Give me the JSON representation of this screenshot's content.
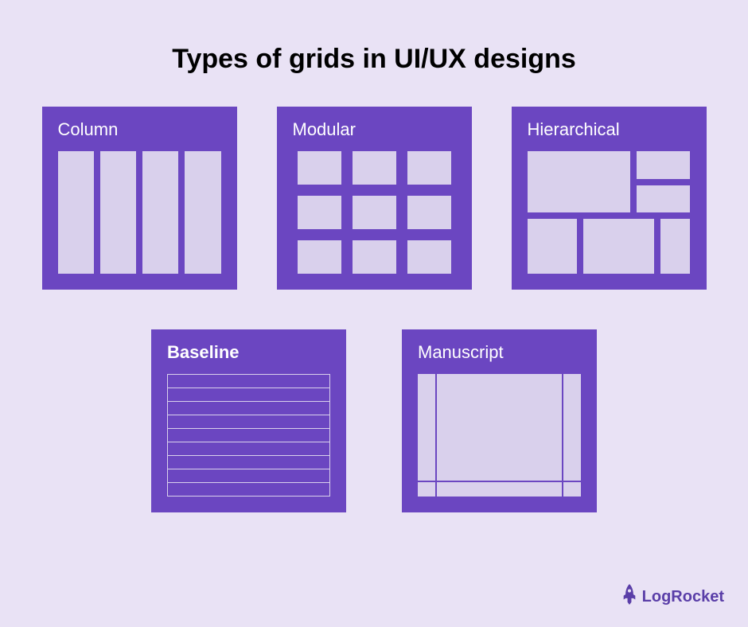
{
  "title": "Types of grids in UI/UX designs",
  "cards": {
    "column": {
      "label": "Column"
    },
    "modular": {
      "label": "Modular"
    },
    "hierarchical": {
      "label": "Hierarchical"
    },
    "baseline": {
      "label": "Baseline"
    },
    "manuscript": {
      "label": "Manuscript"
    }
  },
  "brand": {
    "name": "LogRocket"
  },
  "colors": {
    "background": "#e9e2f5",
    "card": "#6b46c1",
    "fill": "#d9d0ec",
    "text_title": "#000000",
    "text_card": "#ffffff",
    "brand": "#5a3ea8"
  }
}
